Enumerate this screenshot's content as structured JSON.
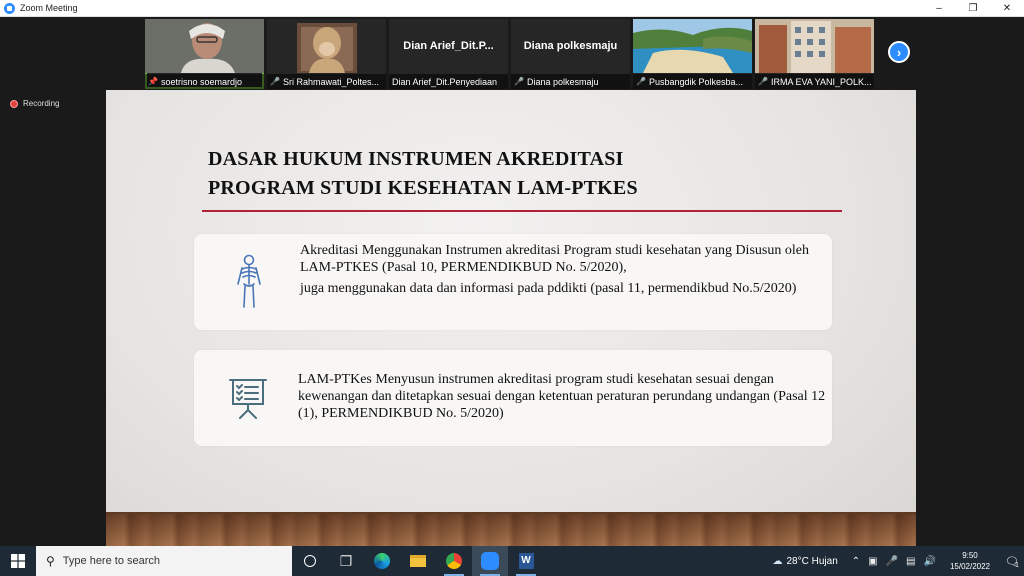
{
  "window": {
    "title": "Zoom Meeting"
  },
  "participants": [
    {
      "name": "soetrisno soemardjo",
      "type": "video",
      "pinned": true
    },
    {
      "name": "Sri Rahmawati_Poltes...",
      "type": "video",
      "muted": true
    },
    {
      "name": "Dian Arief_Dit.Penyediaan",
      "display": "Dian  Arief_Dit.P...",
      "type": "name"
    },
    {
      "name": "Diana polkesmaju",
      "display": "Diana polkesmaju",
      "type": "name",
      "muted": true
    },
    {
      "name": "Pusbangdik Polkesba...",
      "type": "video",
      "muted": true
    },
    {
      "name": "IRMA EVA YANI_POLK...",
      "type": "video",
      "muted": true
    }
  ],
  "recording": {
    "label": "Recording"
  },
  "slide": {
    "title_line1": "DASAR HUKUM INSTRUMEN AKREDITASI",
    "title_line2": "PROGRAM STUDI KESEHATAN LAM-PTKES",
    "card1": {
      "icon": "skeleton-icon",
      "para1": "Akreditasi Menggunakan Instrumen akreditasi Program studi kesehatan yang Disusun oleh LAM-PTKES (Pasal 10, PERMENDIKBUD No. 5/2020),",
      "para2": "juga menggunakan data dan informasi pada pddikti (pasal 11, permendikbud No.5/2020)"
    },
    "card2": {
      "icon": "presentation-board-icon",
      "para1": "LAM-PTKes Menyusun instrumen akreditasi program studi kesehatan sesuai dengan kewenangan dan ditetapkan sesuai dengan ketentuan peraturan perundang undangan (Pasal 12 (1), PERMENDIKBUD No. 5/2020)"
    }
  },
  "taskbar": {
    "search_placeholder": "Type here to search",
    "weather": "28°C  Hujan",
    "time": "9:50",
    "date": "15/02/2022",
    "notification_count": "1"
  },
  "colors": {
    "accent_rule": "#b3203a",
    "zoom_blue": "#2d8cff",
    "active_speaker": "#7ac943"
  }
}
